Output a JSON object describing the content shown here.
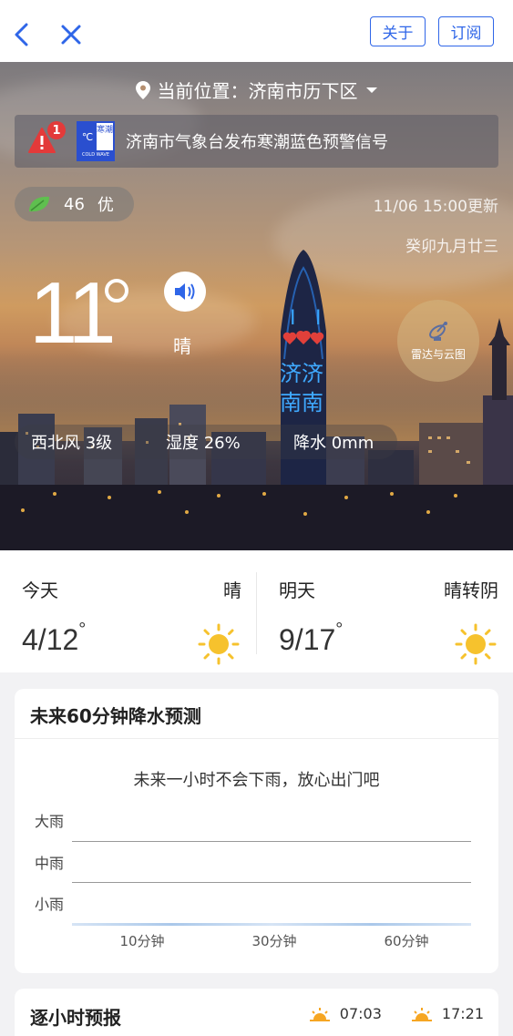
{
  "nav": {
    "about_label": "关于",
    "subscribe_label": "订阅"
  },
  "hero": {
    "location": "当前位置：济南市历下区",
    "warning": {
      "count": "1",
      "text": "济南市气象台发布寒潮蓝色预警信号",
      "signal_icon_title": "寒潮",
      "signal_icon_caption": "COLD WAVE",
      "signal_icon_temp": "℃"
    },
    "aqi": {
      "value": "46",
      "level": "优"
    },
    "update_time": "11/06 15:00更新",
    "lunar_date": "癸卯九月廿三",
    "temperature": "11",
    "condition": "晴",
    "radar_label": "雷达与云图",
    "wind": "西北风 3级",
    "humidity": "湿度 26%",
    "precipitation": "降水 0mm",
    "tower_text_1": "I",
    "tower_text_2": "济济",
    "tower_text_3": "南南"
  },
  "forecast": {
    "today": {
      "label": "今天",
      "condition": "晴",
      "range": "4/12"
    },
    "tomorrow": {
      "label": "明天",
      "condition": "晴转阴",
      "range": "9/17"
    }
  },
  "precip_card": {
    "title": "未来60分钟降水预测",
    "message": "未来一小时不会下雨，放心出门吧",
    "levels": [
      "大雨",
      "中雨",
      "小雨"
    ],
    "ticks": [
      "10分钟",
      "30分钟",
      "60分钟"
    ]
  },
  "hourly": {
    "title": "逐小时预报",
    "sunrise": "07:03",
    "sunset": "17:21"
  },
  "colors": {
    "accent": "#2f66e8",
    "sun": "#f6c22d",
    "warning_red": "#e33a3a"
  }
}
